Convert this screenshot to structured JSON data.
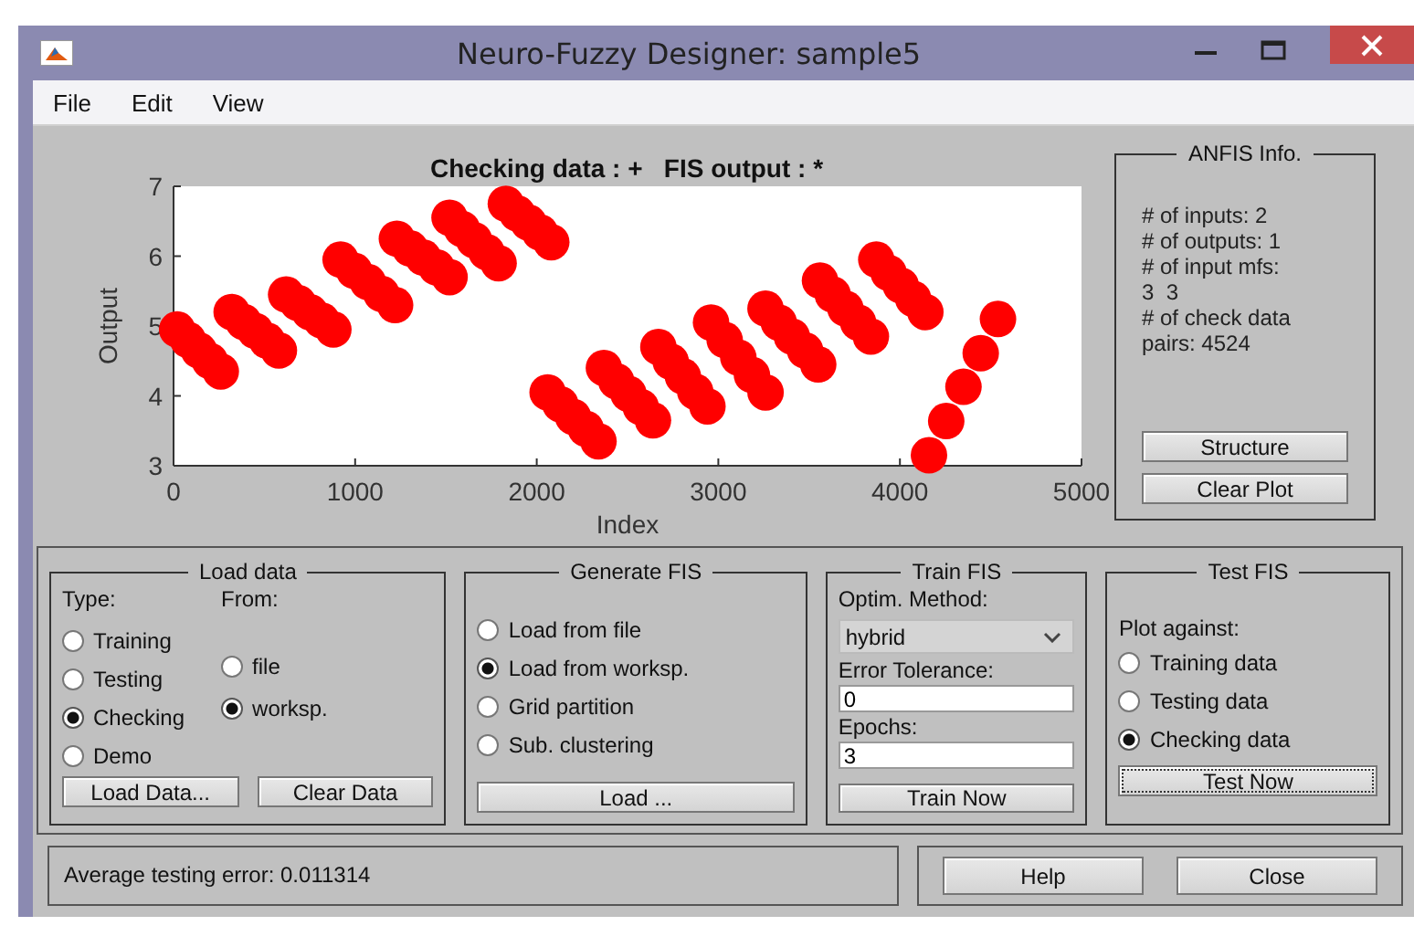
{
  "window": {
    "title": "Neuro-Fuzzy Designer: sample5"
  },
  "menu": [
    "File",
    "Edit",
    "View"
  ],
  "plot": {
    "chart_data": {
      "type": "scatter",
      "title": "Checking data : +   FIS output : *",
      "xlabel": "Index",
      "ylabel": "Output",
      "xlim": [
        0,
        5000
      ],
      "ylim": [
        3,
        7
      ],
      "xticks": [
        0,
        1000,
        2000,
        3000,
        4000,
        5000
      ],
      "yticks": [
        3,
        4,
        5,
        6,
        7
      ],
      "x": [
        20,
        80,
        140,
        200,
        260,
        320,
        385,
        450,
        515,
        580,
        620,
        685,
        750,
        815,
        880,
        920,
        995,
        1070,
        1145,
        1220,
        1230,
        1303,
        1375,
        1448,
        1520,
        1520,
        1588,
        1655,
        1723,
        1790,
        1830,
        1893,
        1955,
        2018,
        2080,
        2060,
        2130,
        2200,
        2270,
        2340,
        2370,
        2438,
        2505,
        2573,
        2640,
        2670,
        2738,
        2805,
        2873,
        2940,
        2960,
        3035,
        3110,
        3185,
        3260,
        3260,
        3333,
        3405,
        3478,
        3550,
        3560,
        3630,
        3700,
        3770,
        3840,
        3870,
        3938,
        4005,
        4073,
        4140,
        4160,
        4255,
        4350,
        4445,
        4540
      ],
      "series": [
        {
          "color": "#ff0000",
          "values": [
            4.95,
            4.8,
            4.65,
            4.5,
            4.35,
            5.2,
            5.06,
            4.93,
            4.79,
            4.65,
            5.45,
            5.33,
            5.2,
            5.08,
            4.95,
            5.95,
            5.79,
            5.63,
            5.46,
            5.3,
            6.25,
            6.11,
            5.98,
            5.84,
            5.7,
            6.55,
            6.39,
            6.23,
            6.06,
            5.9,
            6.75,
            6.61,
            6.48,
            6.34,
            6.2,
            4.05,
            3.88,
            3.7,
            3.53,
            3.35,
            4.4,
            4.21,
            4.03,
            3.84,
            3.65,
            4.7,
            4.49,
            4.28,
            4.06,
            3.85,
            5.05,
            4.8,
            4.55,
            4.3,
            4.05,
            5.25,
            5.05,
            4.85,
            4.65,
            4.45,
            5.65,
            5.45,
            5.25,
            5.05,
            4.85,
            5.95,
            5.76,
            5.58,
            5.39,
            5.2,
            3.15,
            3.64,
            4.13,
            4.61,
            5.1
          ]
        }
      ]
    }
  },
  "anfis_info": {
    "title": "ANFIS Info.",
    "lines": [
      "# of inputs: 2",
      "# of outputs: 1",
      "# of input mfs:",
      "3  3",
      "# of check data",
      "pairs: 4524"
    ],
    "buttons": [
      "Structure",
      "Clear Plot"
    ]
  },
  "load_data": {
    "title": "Load data",
    "type_label": "Type:",
    "from_label": "From:",
    "types": [
      {
        "label": "Training",
        "selected": false
      },
      {
        "label": "Testing",
        "selected": false
      },
      {
        "label": "Checking",
        "selected": true
      },
      {
        "label": "Demo",
        "selected": false
      }
    ],
    "sources": [
      {
        "label": "file",
        "selected": false
      },
      {
        "label": "worksp.",
        "selected": true
      }
    ],
    "buttons": [
      "Load Data...",
      "Clear Data"
    ]
  },
  "generate_fis": {
    "title": "Generate FIS",
    "options": [
      {
        "label": "Load from file",
        "selected": false
      },
      {
        "label": "Load from worksp.",
        "selected": true
      },
      {
        "label": "Grid partition",
        "selected": false
      },
      {
        "label": "Sub. clustering",
        "selected": false
      }
    ],
    "button": "Load ..."
  },
  "train_fis": {
    "title": "Train FIS",
    "method_label": "Optim. Method:",
    "method": "hybrid",
    "tolerance_label": "Error Tolerance:",
    "tolerance": "0",
    "epochs_label": "Epochs:",
    "epochs": "3",
    "button": "Train Now"
  },
  "test_fis": {
    "title": "Test FIS",
    "plot_against_label": "Plot against:",
    "options": [
      {
        "label": "Training data",
        "selected": false
      },
      {
        "label": "Testing data",
        "selected": false
      },
      {
        "label": "Checking data",
        "selected": true
      }
    ],
    "button": "Test Now",
    "button_focused": true
  },
  "status": "Average testing error: 0.011314",
  "buttons": [
    "Help",
    "Close"
  ]
}
